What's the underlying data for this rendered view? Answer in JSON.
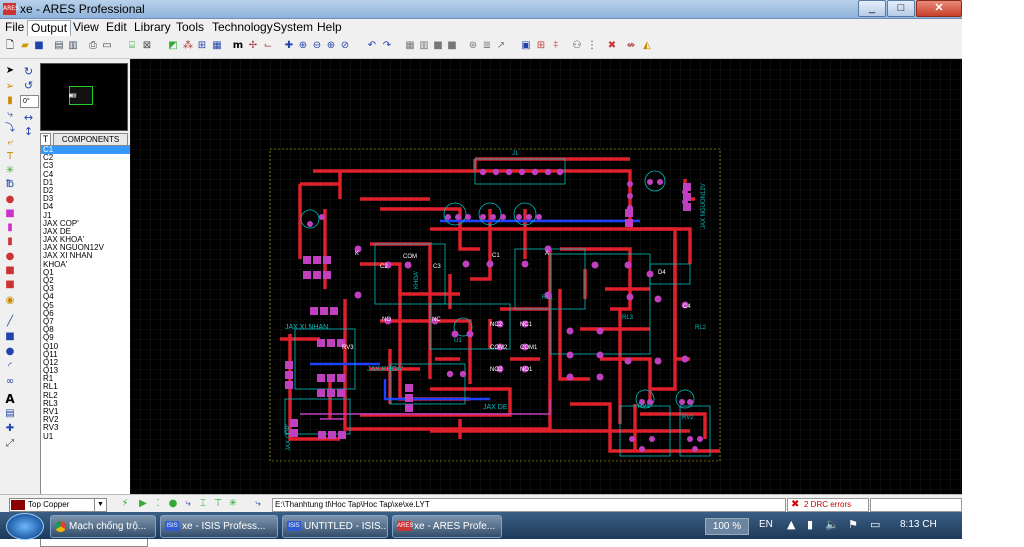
{
  "window": {
    "title": "xe - ARES Professional",
    "app_icon_label": "ARES"
  },
  "window_buttons": {
    "minimize": "_",
    "maximize": "□",
    "close": "✕"
  },
  "menu": [
    {
      "label": "File"
    },
    {
      "label": "Output"
    },
    {
      "label": "View"
    },
    {
      "label": "Edit"
    },
    {
      "label": "Library"
    },
    {
      "label": "Tools"
    },
    {
      "label": "Technology"
    },
    {
      "label": "System"
    },
    {
      "label": "Help"
    }
  ],
  "toolbar_icons": [
    "new-file-icon",
    "open-folder-icon",
    "save-icon",
    "import-icon",
    "export-icon",
    "print-icon",
    "print-setup-icon",
    "area-icon",
    "mark-icon",
    "redraw-icon",
    "grid-toggle-icon",
    "layers-icon",
    "metric-icon",
    "origin-icon",
    "false-origin-icon",
    "pan-icon",
    "zoom-in-icon",
    "zoom-out-icon",
    "zoom-all-icon",
    "zoom-area-icon",
    "undo-icon",
    "redo-icon",
    "block-copy-icon",
    "block-move-icon",
    "block-rotate-icon",
    "block-delete-icon",
    "pick-parts-icon",
    "make-package-icon",
    "decompose-icon",
    "auto-router-icon",
    "net-inspect-icon",
    "search-tag-icon",
    "property-assign-icon",
    "design-rule-icon",
    "connectivity-icon",
    "power-plane-icon"
  ],
  "left_toolbar_icons": [
    "selection-mode-icon",
    "component-mode-icon",
    "package-mode-icon",
    "track-mode-icon",
    "via-mode-icon",
    "zone-mode-icon",
    "ratsnest-mode-icon",
    "connectivity-highlight-icon",
    "round-pad-icon",
    "square-pad-icon",
    "dil-pad-icon",
    "edge-pad-icon",
    "polygon-pad-icon",
    "padstack-icon",
    "line-2d-icon",
    "box-2d-icon",
    "circle-2d-icon",
    "arc-2d-icon",
    "closed-path-icon",
    "text-2d-icon",
    "symbol-2d-icon",
    "marker-2d-icon",
    "dimension-icon"
  ],
  "panel": {
    "rotation_value": "0°",
    "tab_t": "T",
    "tab_components": "COMPONENTS"
  },
  "components": [
    "C1",
    "C2",
    "C3",
    "C4",
    "D1",
    "D2",
    "D3",
    "D4",
    "J1",
    "JAX COP'",
    "JAX DE",
    "JAX KHOA'",
    "JAX NGUON12V",
    "JAX XI NHAN",
    "KHOA'",
    "Q1",
    "Q2",
    "Q3",
    "Q4",
    "Q5",
    "Q6",
    "Q7",
    "Q8",
    "Q9",
    "Q10",
    "Q11",
    "Q12",
    "Q13",
    "R1",
    "RL1",
    "RL2",
    "RL3",
    "RV1",
    "RV2",
    "RV3",
    "U1"
  ],
  "selected_component": "C1",
  "pcb": {
    "labels": {
      "j1": "J1",
      "d4": "D4",
      "u1": "U1",
      "rl1": "RL1",
      "rl2": "RL2",
      "rl3": "RL3",
      "jax_xi_nhan": "JAX XI NHAN",
      "jax_khoa": "JAX KHOA'",
      "jax_de": "JAX DE",
      "jax_nguon12v": "JAX NGUON12V",
      "jax_cop": "JAX COP'",
      "khoa": "KHOA'",
      "rv1": "RV1",
      "rv2": "RV2",
      "rv3": "RV3",
      "c2": "C2",
      "c3": "C3",
      "c1": "C1",
      "c4": "C4",
      "com": "COM",
      "nc": "NC",
      "no": "NO",
      "nc2": "NC2",
      "no1": "NO1",
      "com1": "COM1",
      "com2": "COM2",
      "no2": "NO2",
      "nc1": "NC1",
      "k": "K",
      "a": "A"
    }
  },
  "statusbar": {
    "layer": "Top Copper",
    "path": "E:\\Thanhtung tl\\Hoc Tap\\Hoc Tap\\xe\\xe.LYT",
    "drc": "2 DRC errors"
  },
  "taskbar": {
    "buttons": [
      {
        "label": "Mạch chống trộ...",
        "icon": "chrome-icon"
      },
      {
        "label": "xe - ISIS Profess...",
        "icon": "isis-icon"
      },
      {
        "label": "UNTITLED - ISIS...",
        "icon": "isis-icon"
      },
      {
        "label": "xe - ARES Profe...",
        "icon": "ares-icon"
      }
    ],
    "zoom": "100 %",
    "language": "EN",
    "clock": "8:13 CH"
  },
  "colors": {
    "copper": "#e0202a",
    "pad": "#c040c0",
    "silk": "#00c0c0",
    "grid": "#2a2a2a",
    "selection": "#3399ff"
  }
}
